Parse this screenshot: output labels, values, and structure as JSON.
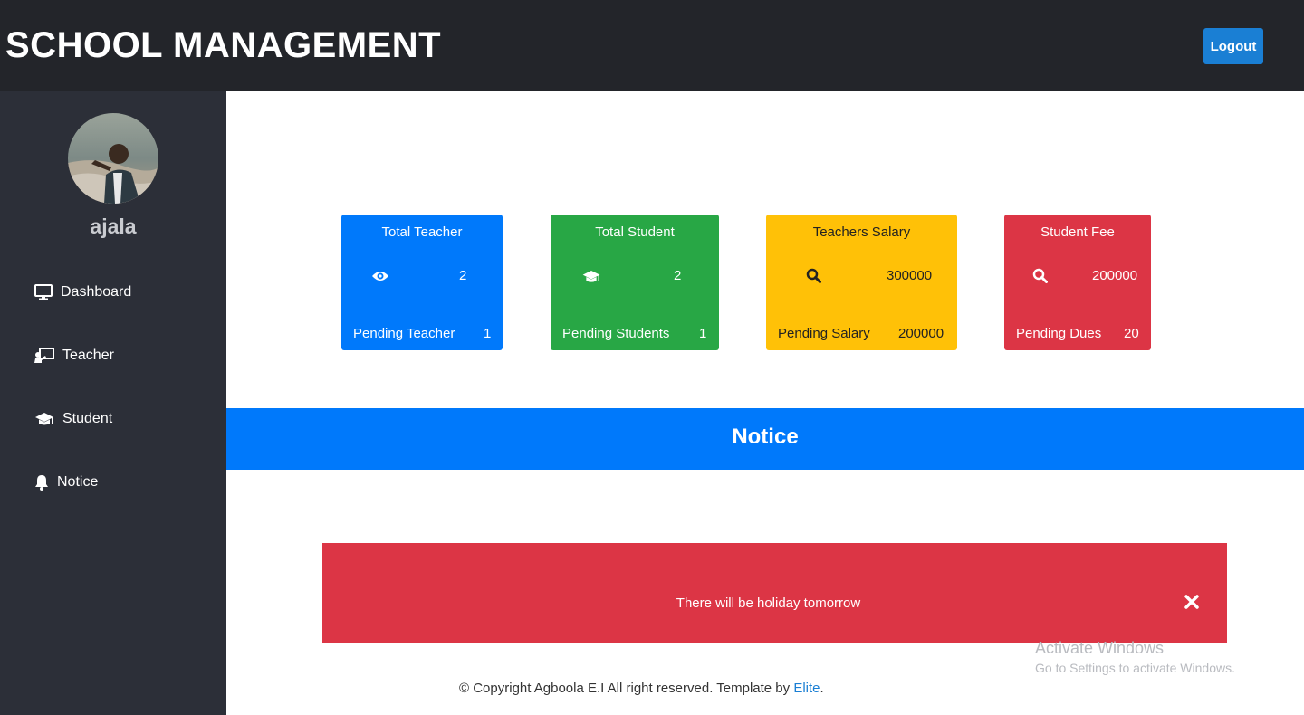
{
  "header": {
    "title": "SCHOOL MANAGEMENT",
    "logout_label": "Logout"
  },
  "sidebar": {
    "username": "ajala",
    "items": [
      {
        "label": "Dashboard",
        "icon": "monitor-icon"
      },
      {
        "label": "Teacher",
        "icon": "chalkboard-teacher-icon"
      },
      {
        "label": "Student",
        "icon": "graduation-cap-icon"
      },
      {
        "label": "Notice",
        "icon": "bell-icon"
      }
    ]
  },
  "cards": [
    {
      "title": "Total Teacher",
      "icon": "eye-icon",
      "value": "2",
      "pending_label": "Pending Teacher",
      "pending_value": "1",
      "color": "#0079fb"
    },
    {
      "title": "Total Student",
      "icon": "graduation-cap-icon",
      "value": "2",
      "pending_label": "Pending Students",
      "pending_value": "1",
      "color": "#28a745"
    },
    {
      "title": "Teachers Salary",
      "icon": "search-icon",
      "value": "300000",
      "pending_label": "Pending Salary",
      "pending_value": "200000",
      "color": "#ffc107"
    },
    {
      "title": "Student Fee",
      "icon": "search-icon",
      "value": "200000",
      "pending_label": "Pending Dues",
      "pending_value": "20",
      "color": "#dc3545"
    }
  ],
  "notice": {
    "heading": "Notice",
    "message": "There will be holiday tomorrow",
    "color": "#dc3545"
  },
  "footer": {
    "text": "© Copyright Agboola E.I All right reserved. Template by ",
    "link": "Elite",
    "suffix": "."
  },
  "watermark": {
    "line1": "Activate Windows",
    "line2": "Go to Settings to activate Windows."
  }
}
